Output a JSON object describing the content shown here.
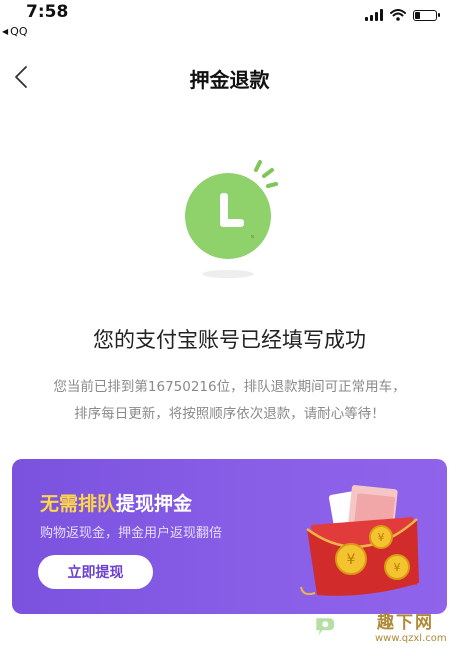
{
  "status_bar": {
    "time": "7:58",
    "back_app": "QQ"
  },
  "nav": {
    "title": "押金退款"
  },
  "result": {
    "headline": "您的支付宝账号已经填写成功",
    "line1": "您当前已排到第16750216位，排队退款期间可正常用车，",
    "line2": "排序每日更新，将按照顺序依次退款，请耐心等待！"
  },
  "banner": {
    "title_highlight": "无需排队",
    "title_rest": "提现押金",
    "subtitle": "购物返现金，押金用户返现翻倍",
    "button_label": "立即提现"
  },
  "watermark": {
    "brand": "趣下网",
    "url": "www.qzxl.com"
  },
  "colors": {
    "clock_green": "#8fd16a",
    "banner_purple": "#8058e4",
    "banner_highlight": "#ffd54a",
    "button_text": "#6b3fd6"
  },
  "icons": [
    "back-chevron-icon",
    "clock-icon",
    "signal-icon",
    "wifi-icon",
    "battery-icon",
    "red-envelope-icon"
  ]
}
